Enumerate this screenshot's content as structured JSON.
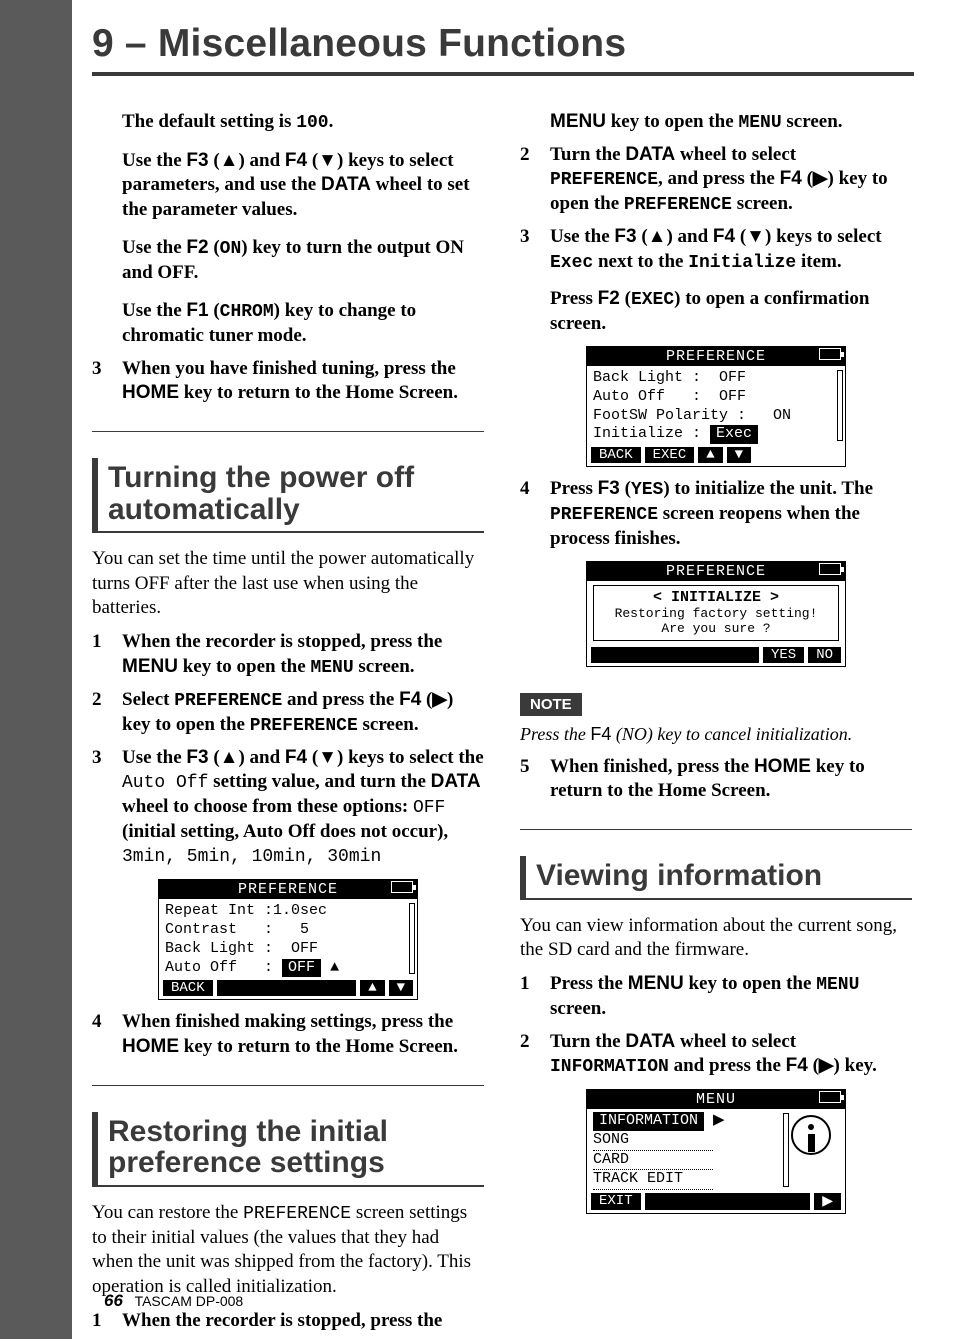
{
  "chapter": "9 – Miscellaneous Functions",
  "col1": {
    "p1_a": "The default setting is ",
    "p1_code": "100",
    "p1_b": ".",
    "p2_a": "Use the ",
    "p2_f3": "F3",
    "p2_b": " (▲) and ",
    "p2_f4": "F4",
    "p2_c": " (▼) keys to select parameters, and use the ",
    "p2_data": "DATA",
    "p2_d": " wheel to set the parameter values.",
    "p3_a": "Use the ",
    "p3_f2": "F2",
    "p3_b": " (",
    "p3_on": "ON",
    "p3_c": ") key to turn the output ON and OFF.",
    "p4_a": "Use the ",
    "p4_f1": "F1",
    "p4_b": " (",
    "p4_chrom": "CHROM",
    "p4_c": ") key to change to chromatic tuner mode.",
    "s3a_num": "3",
    "s3a": "When you have finished tuning, press the ",
    "s3a_home": "HOME",
    "s3a2": " key to return to the Home Screen.",
    "sec1": "Turning the power off automatically",
    "sec1_p": "You can set the time until the power automatically turns OFF after the last use when using the batteries.",
    "s1_num": "1",
    "s1a": "When the recorder is stopped, press the ",
    "s1_menu": "MENU",
    "s1b": " key to open the ",
    "s1c": "MENU",
    "s1d": " screen.",
    "s2_num": "2",
    "s2a": "Select ",
    "s2_pref": "PREFERENCE",
    "s2b": " and press the ",
    "s2_f4": "F4",
    "s2c": " (▶) key to open the ",
    "s2_pref2": "PREFERENCE",
    "s2d": " screen.",
    "s3_num": "3",
    "s3x_a": "Use the ",
    "s3x_f3": "F3",
    "s3x_b": " (▲) and ",
    "s3x_f4": "F4",
    "s3x_c": " (▼) keys to select the ",
    "s3x_auto": "Auto Off",
    "s3x_d": " setting value, and turn the ",
    "s3x_data": "DATA",
    "s3x_e": " wheel to choose from these options: ",
    "s3x_off": "OFF",
    "s3x_f": " (initial setting, Auto Off does not occur), ",
    "s3x_opts": "3min, 5min, 10min, 30min",
    "lcd1": {
      "title": "PREFERENCE",
      "r1": "Repeat Int :1.0sec",
      "r2": "Contrast   :   5",
      "r3": "Back Light :  OFF",
      "r4_lbl": "Auto Off   :",
      "r4_val": "OFF",
      "f1": "BACK",
      "f3": "▲",
      "f4": "▼"
    },
    "s4_num": "4",
    "s4a": "When finished making settings, press the ",
    "s4_home": "HOME",
    "s4b": " key to return to the Home Screen.",
    "sec2": "Restoring the initial preference settings",
    "sec2_p_a": "You can restore the ",
    "sec2_p_pref": "PREFERENCE",
    "sec2_p_b": " screen settings to their initial values (the values that they had when the unit was shipped from the factory). This operation is called initialization.",
    "s5_num": "1",
    "s5": "When the recorder is stopped, press the"
  },
  "col2": {
    "cont_a": "MENU",
    "cont_b": " key to open the ",
    "cont_c": "MENU",
    "cont_d": " screen.",
    "s2_num": "2",
    "s2a": "Turn the ",
    "s2_data": "DATA",
    "s2b": " wheel to select ",
    "s2_pref": "PREFERENCE",
    "s2c": ", and press the ",
    "s2_f4": "F4",
    "s2d": " (▶) key to open the ",
    "s2_pref2": "PREFERENCE",
    "s2e": " screen.",
    "s3_num": "3",
    "s3a": "Use the ",
    "s3_f3": "F3",
    "s3b": " (▲) and ",
    "s3_f4": "F4",
    "s3c": " (▼) keys to select ",
    "s3_exec": "Exec",
    "s3d": " next to the ",
    "s3_init": "Initialize",
    "s3e": " item.",
    "s3f": "Press ",
    "s3_f2": "F2",
    "s3g": " (",
    "s3_execc": "EXEC",
    "s3h": ") to open a confirmation screen.",
    "lcd2": {
      "title": "PREFERENCE",
      "r1": "Back Light :  OFF",
      "r2": "Auto Off   :  OFF",
      "r3": "FootSW Polarity :   ON",
      "r4_lbl": "Initialize :",
      "r4_val": "Exec",
      "f1": "BACK",
      "f2": "EXEC",
      "f3": "▲",
      "f4": "▼"
    },
    "s4_num": "4",
    "s4a": "Press ",
    "s4_f3": "F3",
    "s4b": " (",
    "s4_yes": "YES",
    "s4c": ") to initialize the unit. The ",
    "s4_pref": "PREFERENCE",
    "s4d": " screen reopens when the process finishes.",
    "lcd3": {
      "title": "PREFERENCE",
      "line1": "< INITIALIZE >",
      "line2": "Restoring factory setting!",
      "line3": "Are you sure ?",
      "f3": "YES",
      "f4": "NO"
    },
    "note_label": "NOTE",
    "note_a": "Press the ",
    "note_f4": "F4",
    "note_b": " (",
    "note_no": "NO",
    "note_c": ") key to cancel initialization.",
    "s5_num": "5",
    "s5a": "When finished, press the ",
    "s5_home": "HOME",
    "s5b": " key to return to the Home Screen.",
    "sec3": "Viewing information",
    "sec3_p": "You can view information about the current song, the SD card and the firmware.",
    "v1_num": "1",
    "v1a": "Press the ",
    "v1_menu": "MENU",
    "v1b": " key to open the ",
    "v1c": "MENU",
    "v1d": " screen.",
    "v2_num": "2",
    "v2a": "Turn the ",
    "v2_data": "DATA",
    "v2b": " wheel to select ",
    "v2_info": "INFORMATION",
    "v2c": " and press the ",
    "v2_f4": "F4",
    "v2d": " (▶) key.",
    "lcd4": {
      "title": "MENU",
      "r1": "INFORMATION",
      "r2": "SONG",
      "r3": "CARD",
      "r4": "TRACK EDIT",
      "f1": "EXIT",
      "f4": "▶"
    }
  },
  "footer": {
    "page": "66",
    "model": "TASCAM  DP-008"
  }
}
